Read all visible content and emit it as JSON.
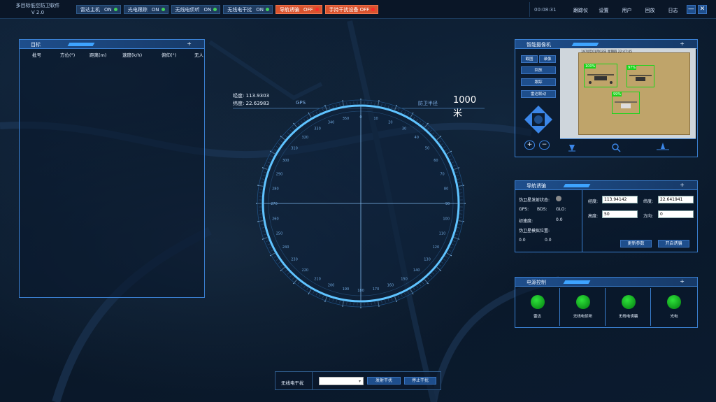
{
  "app": {
    "title_line1": "多目标低空防卫软件",
    "title_line2": "V 2.0"
  },
  "toggles": [
    {
      "label": "雷达主机",
      "state": "ON",
      "on": true
    },
    {
      "label": "光电跟踪",
      "state": "ON",
      "on": true
    },
    {
      "label": "无线电侦听",
      "state": "ON",
      "on": true
    },
    {
      "label": "无线电干扰",
      "state": "ON",
      "on": true
    },
    {
      "label": "导航诱骗",
      "state": "OFF",
      "on": false
    },
    {
      "label": "手持干扰设备",
      "state": "OFF",
      "on": false
    }
  ],
  "clock": "00:08:31",
  "topnav": [
    "跟踪仪",
    "设置",
    "用户",
    "回放",
    "日志"
  ],
  "window_buttons": {
    "minimize": "—",
    "close": "✕"
  },
  "targets": {
    "title": "目标",
    "add": "+",
    "columns": [
      "批号",
      "方位(°)",
      "距离(m)",
      "速度(k/h)",
      "俯仰(°)",
      "无人"
    ]
  },
  "radar": {
    "longitude": "经度: 113.9303",
    "latitude": "纬度: 22.63983",
    "gps_label": "GPS",
    "defense_label": "防卫半径",
    "range": "1000米",
    "bearing_labels": [
      "0",
      "10",
      "20",
      "30",
      "40",
      "50",
      "60",
      "70",
      "80",
      "90",
      "100",
      "110",
      "120",
      "130",
      "140",
      "150",
      "160",
      "170",
      "180",
      "190",
      "200",
      "210",
      "220",
      "230",
      "240",
      "250",
      "260",
      "270",
      "280",
      "290",
      "300",
      "310",
      "320",
      "330",
      "340",
      "350"
    ]
  },
  "camera": {
    "title": "智能摄像机",
    "add": "+",
    "buttons": {
      "snapshot": "截图",
      "record": "录像",
      "playback": "回放",
      "track": "跟踪",
      "radar_link": "雷达联动"
    },
    "zoom_in": "+",
    "zoom_out": "−",
    "timestamp": "1970年01月02日  星期四  22:47:45",
    "detections": [
      "100%",
      "97%",
      "99%"
    ]
  },
  "nav_spoof": {
    "title": "导航诱骗",
    "add": "+",
    "sat_status_label": "伪卫星发射状态:",
    "gps": "GPS:",
    "bds": "BDS:",
    "glo": "GLO:",
    "init_speed_label": "初速度:",
    "init_speed_value": "0.0",
    "sim_pos_label": "伪卫星模拟位置:",
    "sim_pos_x": "0.0",
    "sim_pos_y": "0.0",
    "lon_label": "经度:",
    "lon_value": "113.94142",
    "lat_label": "纬度:",
    "lat_value": "22.641941",
    "alt_label": "高度:",
    "alt_value": "50",
    "dir_label": "方向:",
    "dir_value": "0",
    "update_button": "更新参数",
    "start_button": "开启诱骗"
  },
  "power": {
    "title": "电源控制",
    "add": "+",
    "items": [
      "雷达",
      "无线电侦听",
      "无线电诱骗",
      "光电"
    ]
  },
  "jammer": {
    "label": "无线电干扰",
    "select_value": "",
    "fire_button": "发射干扰",
    "stop_button": "停止干扰"
  }
}
